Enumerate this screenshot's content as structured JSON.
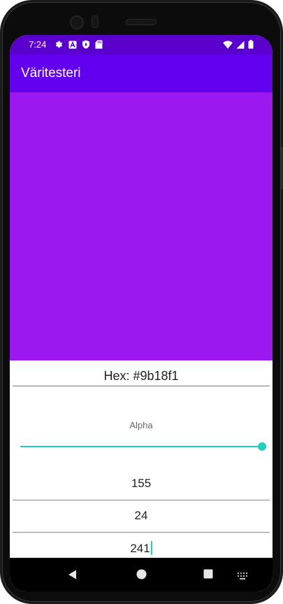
{
  "status_bar": {
    "time": "7:24",
    "left_icons": [
      "settings-icon",
      "a-notification-icon",
      "shield-icon",
      "sd-card-icon"
    ],
    "right_icons": [
      "wifi-icon",
      "cell-signal-icon",
      "battery-icon"
    ]
  },
  "app_bar": {
    "title": "Väritesteri",
    "color": "#6200ee"
  },
  "preview": {
    "color": "#9b18f1"
  },
  "hex": {
    "label": "Hex: #9b18f1"
  },
  "alpha": {
    "label": "Alpha",
    "level": 1.0
  },
  "fields": {
    "red": "155",
    "green": "24",
    "blue": "241"
  },
  "colors": {
    "accent": "#1fd0c0",
    "status_bar": "#5a00cc"
  },
  "nav_bar": {
    "icons": [
      "back-icon",
      "home-icon",
      "recents-icon",
      "keyboard-icon"
    ]
  }
}
